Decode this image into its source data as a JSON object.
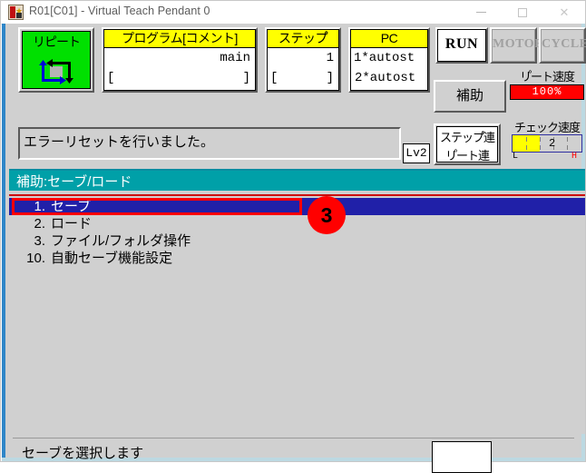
{
  "window": {
    "title": "R01[C01] - Virtual Teach Pendant 0",
    "icon": "app-icon",
    "controls": {
      "minimize": "—",
      "maximize": "□",
      "close": "✕"
    }
  },
  "toolbar": {
    "mode_button": {
      "label": "リピート",
      "icon": "cyclic-arrows-icon",
      "active_color": "#00e000"
    },
    "program_panel": {
      "caption": "プログラム[コメント]",
      "value": "main",
      "comment_open": "[",
      "comment_close": "]"
    },
    "step_panel": {
      "caption": "ステップ゚",
      "value": "1",
      "comment_open": "[",
      "comment_close": "]"
    },
    "pc_panel": {
      "caption": "PC",
      "line1": "1*autost",
      "line2": "2*autost"
    },
    "status_buttons": [
      {
        "label": "RUN",
        "state": "active"
      },
      {
        "label": "MOTOR",
        "state": "disabled"
      },
      {
        "label": "CYCLE",
        "state": "disabled"
      }
    ],
    "aux_button": {
      "label": "補助"
    },
    "repeat_speed": {
      "label": "リ゚ート速度",
      "value": "100%",
      "bar_color": "#ff0000",
      "percent": 100
    },
    "check_speed": {
      "label": "チェック速度",
      "value": "2",
      "bar_color": "#ffff00",
      "percent": 40,
      "low_mark": "L",
      "high_mark": "H"
    },
    "continuous_button": {
      "line1": "ステップ゚連",
      "line2": "リ゚ート連"
    }
  },
  "message_bar": {
    "text": "エラーリセットを行いました。",
    "level_badge": "Lv2"
  },
  "content": {
    "section_title": "補助:セーブ/ロード",
    "header_color": "#00a0a8",
    "rule_color": "#cc0000",
    "menu": [
      {
        "num": "1.",
        "label": "セーブ",
        "selected": true
      },
      {
        "num": "2.",
        "label": "ロード",
        "selected": false
      },
      {
        "num": "3.",
        "label": "ファイル/フォルダ操作",
        "selected": false
      },
      {
        "num": "10.",
        "label": "自動セーブ機能設定",
        "selected": false
      }
    ],
    "annotation_badge": {
      "text": "3",
      "color": "#ff0000"
    },
    "selection_highlight_color": "#2020a8",
    "selection_ring_color": "#ff0000"
  },
  "bottom_bar": {
    "text": "セーブを選択します",
    "input_value": ""
  }
}
